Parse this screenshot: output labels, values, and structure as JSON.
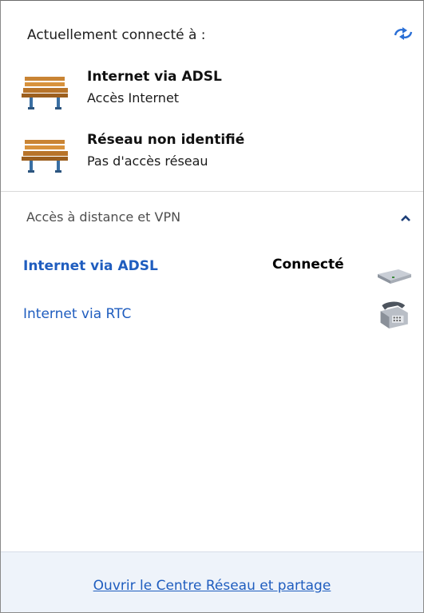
{
  "header": {
    "connected_label": "Actuellement connecté à :",
    "refresh_icon": "refresh-arrows-icon"
  },
  "networks": [
    {
      "title": "Internet via ADSL",
      "subtitle": "Accès Internet",
      "icon": "network-bench-icon"
    },
    {
      "title": "Réseau non identifié",
      "subtitle": "Pas d'accès réseau",
      "icon": "network-bench-icon"
    }
  ],
  "vpn": {
    "header": "Accès à distance et VPN",
    "collapse_icon": "chevron-up-icon",
    "connections": [
      {
        "name": "Internet via ADSL",
        "status": "Connecté",
        "icon": "modem-icon",
        "active": true
      },
      {
        "name": "Internet via RTC",
        "status": "",
        "icon": "telephone-modem-icon",
        "active": false
      }
    ]
  },
  "footer": {
    "link": "Ouvrir le Centre Réseau et partage"
  },
  "colors": {
    "link": "#1f5dbf",
    "footer_bg": "#eef3fa",
    "divider": "#d9d9d9"
  }
}
